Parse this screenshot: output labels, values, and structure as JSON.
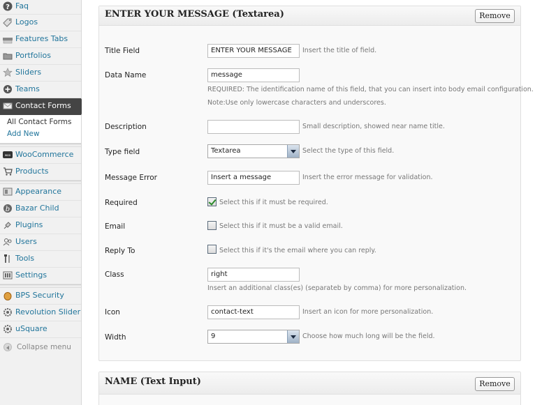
{
  "sidebar": {
    "items_top": [
      {
        "label": "Faq",
        "icon": "help-icon"
      },
      {
        "label": "Logos",
        "icon": "tag-icon"
      },
      {
        "label": "Features Tabs",
        "icon": "tabs-icon"
      },
      {
        "label": "Portfolios",
        "icon": "folder-icon"
      },
      {
        "label": "Sliders",
        "icon": "star-icon"
      },
      {
        "label": "Teams",
        "icon": "plus-circle-icon"
      }
    ],
    "active": {
      "label": "Contact Forms",
      "icon": "mail-icon"
    },
    "submenu": [
      "All Contact Forms",
      "Add New"
    ],
    "items_mid": [
      {
        "label": "WooCommerce",
        "icon": "woo-icon"
      },
      {
        "label": "Products",
        "icon": "cart-icon"
      }
    ],
    "items_app": [
      {
        "label": "Appearance",
        "icon": "appearance-icon"
      },
      {
        "label": "Bazar Child",
        "icon": "bazar-icon"
      },
      {
        "label": "Plugins",
        "icon": "plug-icon"
      },
      {
        "label": "Users",
        "icon": "users-icon"
      },
      {
        "label": "Tools",
        "icon": "tools-icon"
      },
      {
        "label": "Settings",
        "icon": "settings-icon"
      }
    ],
    "items_bottom": [
      {
        "label": "BPS Security",
        "icon": "shield-icon"
      },
      {
        "label": "Revolution Slider",
        "icon": "gear-icon"
      },
      {
        "label": "uSquare",
        "icon": "gear-icon"
      }
    ],
    "collapse": "Collapse menu"
  },
  "field1": {
    "title": "ENTER YOUR MESSAGE (Textarea)",
    "remove": "Remove",
    "title_field": {
      "label": "Title Field",
      "value": "ENTER YOUR MESSAGE",
      "help": "Insert the title of field."
    },
    "data_name": {
      "label": "Data Name",
      "value": "message",
      "help1": "REQUIRED: The identification name of this field, that you can insert into body email configuration.",
      "help2": "Note:Use only lowercase characters and underscores."
    },
    "description": {
      "label": "Description",
      "value": "",
      "help": "Small description, showed near name title."
    },
    "type_field": {
      "label": "Type field",
      "value": "Textarea",
      "help": "Select the type of this field."
    },
    "message_error": {
      "label": "Message Error",
      "value": "Insert a message",
      "help": "Insert the error message for validation."
    },
    "required": {
      "label": "Required",
      "checked": true,
      "help": "Select this if it must be required."
    },
    "email": {
      "label": "Email",
      "checked": false,
      "help": "Select this if it must be a valid email."
    },
    "reply_to": {
      "label": "Reply To",
      "checked": false,
      "help": "Select this if it's the email where you can reply."
    },
    "class": {
      "label": "Class",
      "value": "right",
      "help": "Insert an additional class(es) (separateb by comma) for more personalization."
    },
    "icon": {
      "label": "Icon",
      "value": "contact-text",
      "help": "Insert an icon for more personalization."
    },
    "width": {
      "label": "Width",
      "value": "9",
      "help": "Choose how much long will be the field."
    }
  },
  "field2": {
    "title": "NAME (Text Input)",
    "remove": "Remove"
  }
}
